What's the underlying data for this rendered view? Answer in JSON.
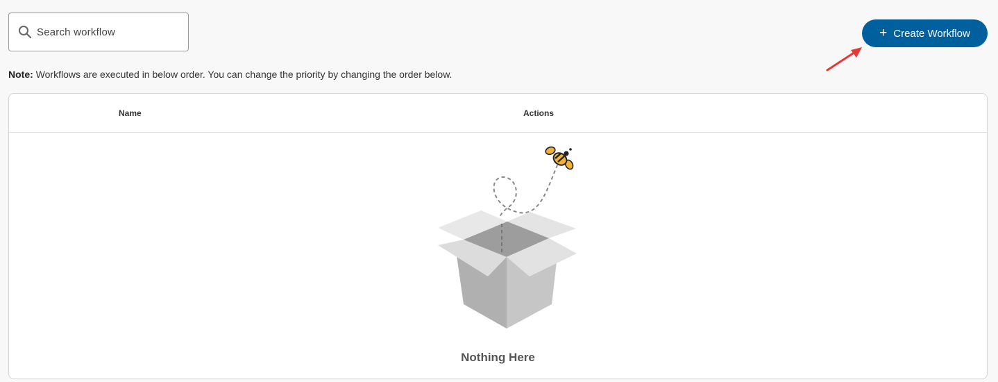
{
  "search": {
    "placeholder": "Search workflow"
  },
  "toolbar": {
    "create_label": "Create Workflow",
    "create_icon": "plus-icon"
  },
  "note": {
    "prefix": "Note:",
    "text": "Workflows are executed in below order. You can change the priority by changing the order below."
  },
  "table": {
    "columns": [
      "Name",
      "Actions"
    ],
    "rows": []
  },
  "empty_state": {
    "message": "Nothing Here",
    "illustration": "open-box-with-bee"
  },
  "colors": {
    "accent": "#00609e",
    "annotation_arrow": "#e53935",
    "background": "#f8f8f8"
  }
}
